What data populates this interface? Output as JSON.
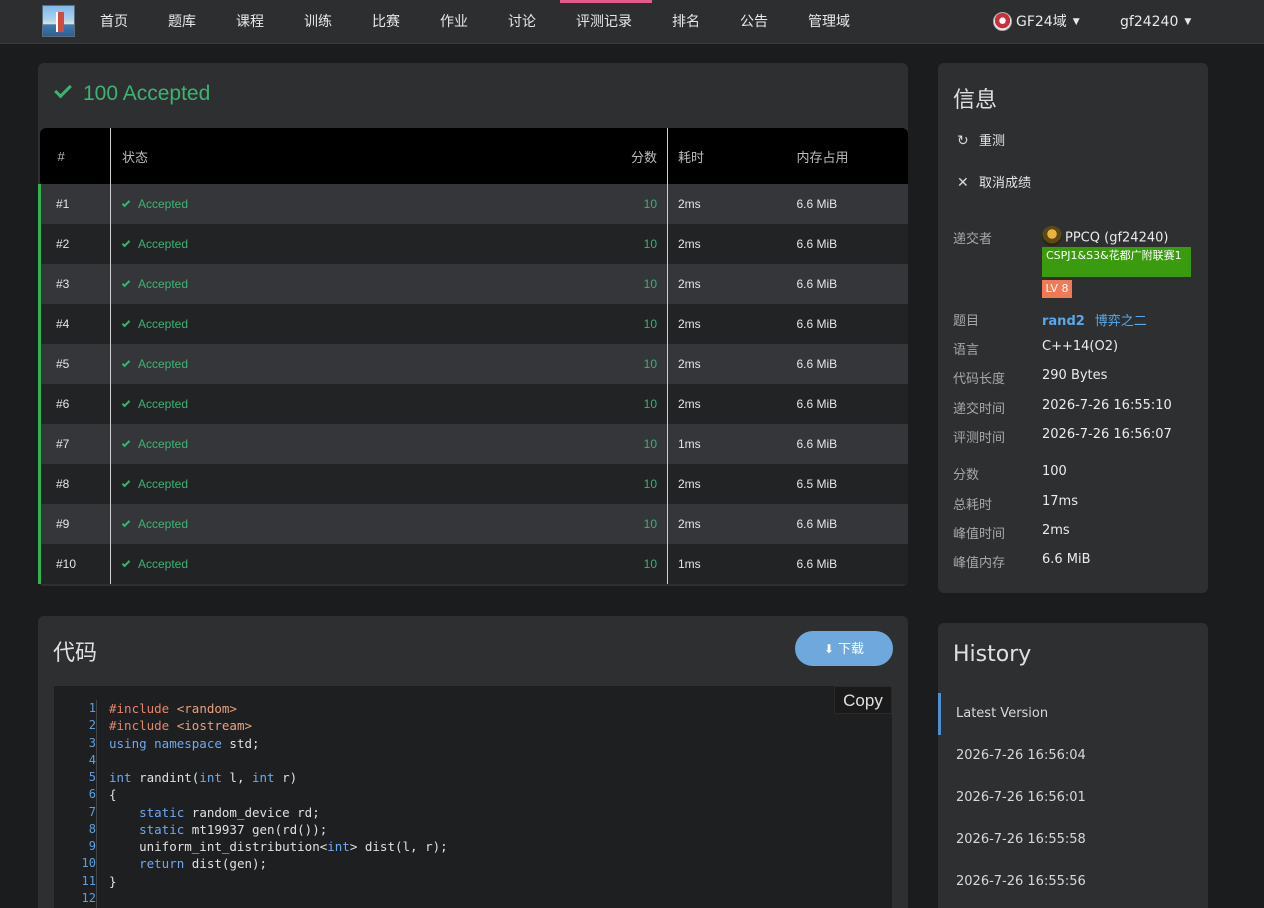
{
  "nav": {
    "items": [
      {
        "label": "首页"
      },
      {
        "label": "题库"
      },
      {
        "label": "课程"
      },
      {
        "label": "训练"
      },
      {
        "label": "比赛"
      },
      {
        "label": "作业"
      },
      {
        "label": "讨论"
      },
      {
        "label": "评测记录"
      },
      {
        "label": "排名"
      },
      {
        "label": "公告"
      },
      {
        "label": "管理域"
      }
    ],
    "active": "评测记录",
    "domain": "GF24域",
    "user": "gf24240"
  },
  "result": {
    "score": "100",
    "status": "Accepted",
    "columns": {
      "index": "#",
      "status": "状态",
      "score": "分数",
      "time": "耗时",
      "memory": "内存占用"
    },
    "cases": [
      {
        "index": "#1",
        "status": "Accepted",
        "score": "10",
        "time": "2ms",
        "memory": "6.6 MiB"
      },
      {
        "index": "#2",
        "status": "Accepted",
        "score": "10",
        "time": "2ms",
        "memory": "6.6 MiB"
      },
      {
        "index": "#3",
        "status": "Accepted",
        "score": "10",
        "time": "2ms",
        "memory": "6.6 MiB"
      },
      {
        "index": "#4",
        "status": "Accepted",
        "score": "10",
        "time": "2ms",
        "memory": "6.6 MiB"
      },
      {
        "index": "#5",
        "status": "Accepted",
        "score": "10",
        "time": "2ms",
        "memory": "6.6 MiB"
      },
      {
        "index": "#6",
        "status": "Accepted",
        "score": "10",
        "time": "2ms",
        "memory": "6.6 MiB"
      },
      {
        "index": "#7",
        "status": "Accepted",
        "score": "10",
        "time": "1ms",
        "memory": "6.6 MiB"
      },
      {
        "index": "#8",
        "status": "Accepted",
        "score": "10",
        "time": "2ms",
        "memory": "6.5 MiB"
      },
      {
        "index": "#9",
        "status": "Accepted",
        "score": "10",
        "time": "2ms",
        "memory": "6.6 MiB"
      },
      {
        "index": "#10",
        "status": "Accepted",
        "score": "10",
        "time": "1ms",
        "memory": "6.6 MiB"
      }
    ]
  },
  "code": {
    "title": "代码",
    "download_label": "下载",
    "copy_label": "Copy",
    "line_numbers": [
      "1",
      "2",
      "3",
      "4",
      "5",
      "6",
      "7",
      "8",
      "9",
      "10",
      "11",
      "12"
    ]
  },
  "info": {
    "title": "信息",
    "rejudge_label": "重测",
    "cancel_label": "取消成绩",
    "submitter_label": "递交者",
    "submitter_name": "PPCQ (gf24240)",
    "group_badge": "CSPJ1&S3&花都广附联赛1",
    "level_badge": "LV 8",
    "problem_label": "题目",
    "problem_id": "rand2",
    "problem_title": "博弈之二",
    "language_label": "语言",
    "language": "C++14(O2)",
    "code_length_label": "代码长度",
    "code_length": "290 Bytes",
    "submit_time_label": "递交时间",
    "submit_time": "2026-7-26 16:55:10",
    "judge_time_label": "评测时间",
    "judge_time": "2026-7-26 16:56:07",
    "score_label": "分数",
    "score": "100",
    "total_time_label": "总耗时",
    "total_time": "17ms",
    "peak_time_label": "峰值时间",
    "peak_time": "2ms",
    "peak_memory_label": "峰值内存",
    "peak_memory": "6.6 MiB"
  },
  "history": {
    "title": "History",
    "items": [
      {
        "label": "Latest Version"
      },
      {
        "label": "2026-7-26 16:56:04"
      },
      {
        "label": "2026-7-26 16:56:01"
      },
      {
        "label": "2026-7-26 16:55:58"
      },
      {
        "label": "2026-7-26 16:55:56"
      }
    ]
  },
  "colors": {
    "accent": "#3cb371",
    "nav_active": "#e55c8a",
    "link": "#5aa8e8",
    "group_badge": "#3a9b0f",
    "level_badge": "#f07a55"
  }
}
